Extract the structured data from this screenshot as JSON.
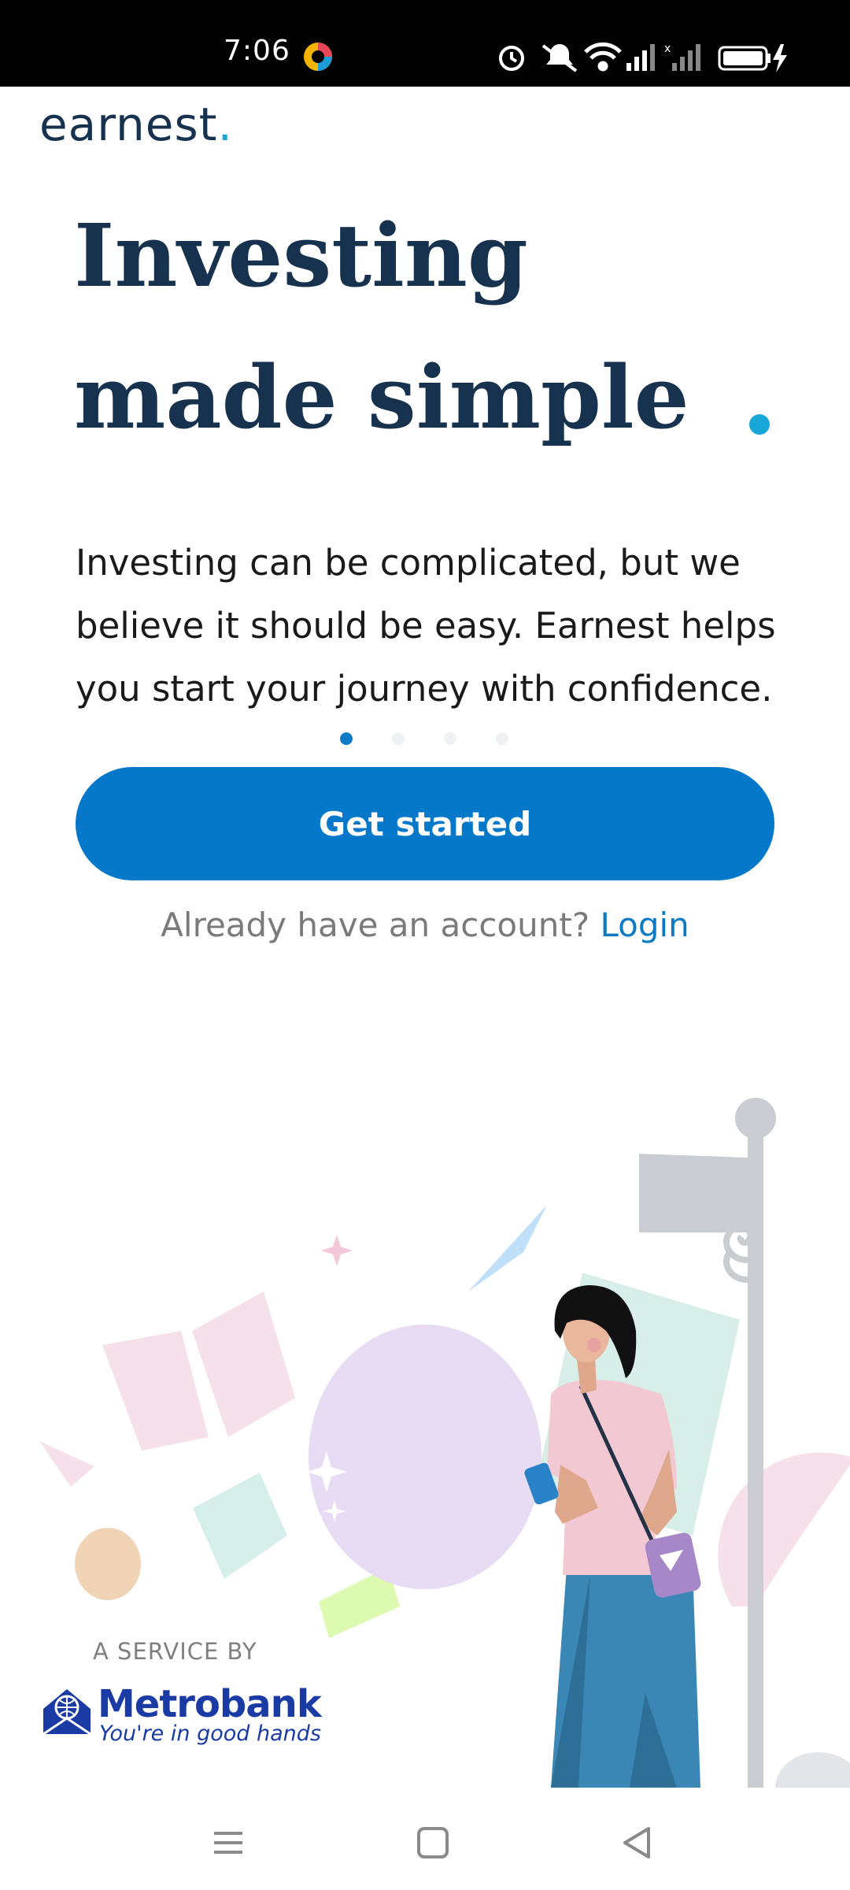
{
  "status_bar": {
    "time": "7:06",
    "icons": [
      "alarm-icon",
      "mute-icon",
      "wifi-icon",
      "signal-icon",
      "signal-no-sim-icon",
      "battery-icon",
      "charging-icon"
    ]
  },
  "logo": {
    "text": "earnest",
    "dot": ".",
    "accent_color": "#18a7d8"
  },
  "hero": {
    "line1": "Investing",
    "line2": "made simple",
    "description": "Investing can be complicated, but we believe it should be easy. Earnest helps you start your journey with confidence."
  },
  "carousel": {
    "total": 4,
    "active_index": 0
  },
  "cta": {
    "label": "Get started",
    "color": "#0678c9"
  },
  "login": {
    "prompt": "Already have an account?",
    "link": "Login"
  },
  "service": {
    "label": "A SERVICE BY",
    "brand": "Metrobank",
    "tagline": "You're in good hands"
  },
  "nav": {
    "buttons": [
      "menu-icon",
      "home-icon",
      "back-icon"
    ]
  }
}
